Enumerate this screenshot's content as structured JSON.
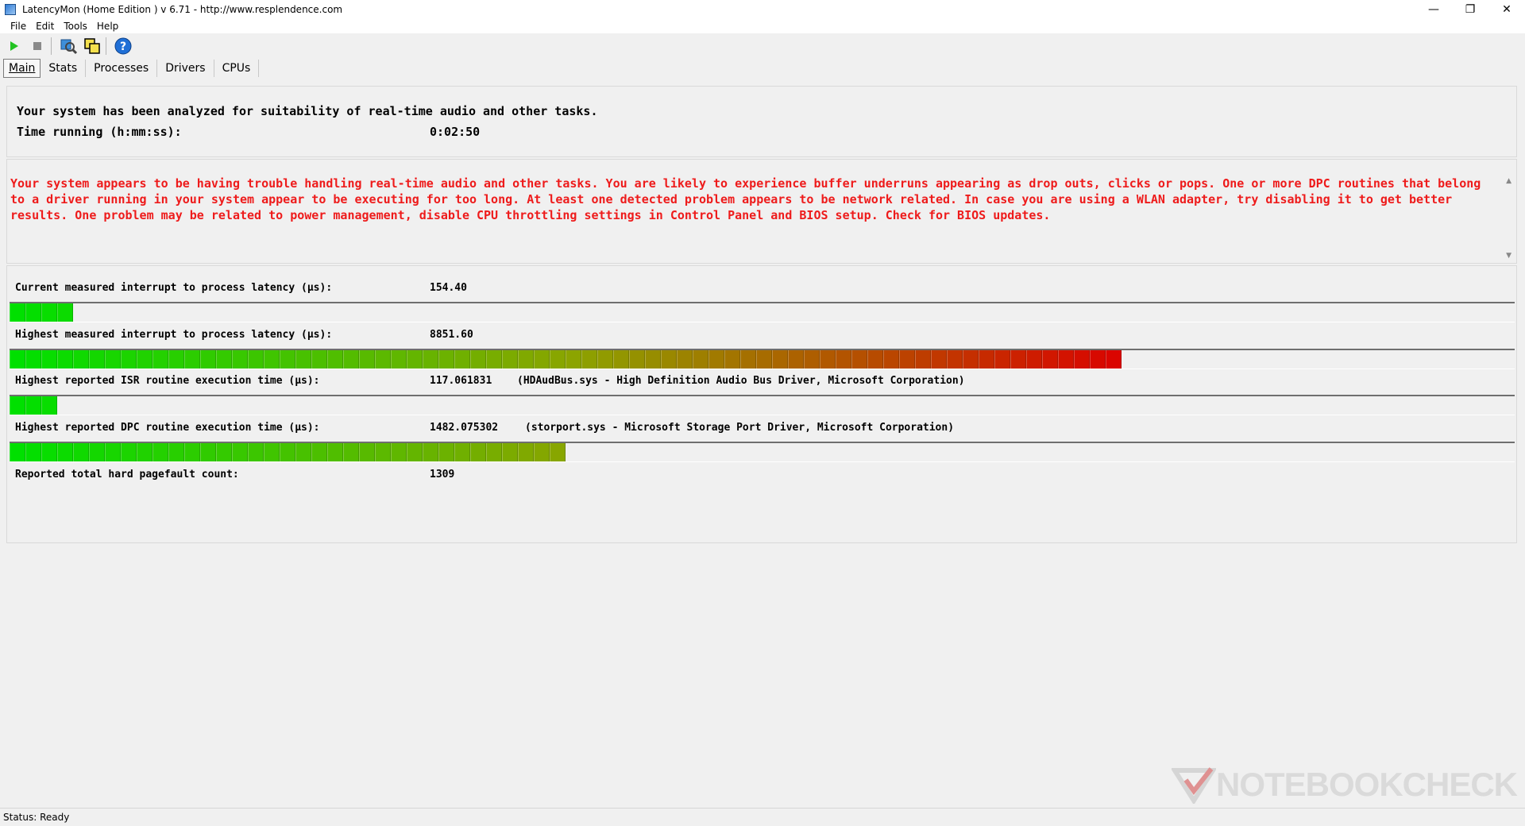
{
  "window": {
    "title": "LatencyMon  (Home Edition )  v 6.71 - http://www.resplendence.com",
    "controls": {
      "minimize": "—",
      "restore": "❐",
      "close": "✕"
    }
  },
  "menu": [
    "File",
    "Edit",
    "Tools",
    "Help"
  ],
  "toolbar": {
    "icons": [
      "play-icon",
      "stop-icon",
      "analyze-icon",
      "copy-windows-icon",
      "help-icon"
    ],
    "colors": {
      "play": "#22c322",
      "stop": "#8a8a8a",
      "help": "#1f6fd6"
    }
  },
  "tabs": [
    {
      "label": "Main",
      "active": true
    },
    {
      "label": "Stats",
      "active": false
    },
    {
      "label": "Processes",
      "active": false
    },
    {
      "label": "Drivers",
      "active": false
    },
    {
      "label": "CPUs",
      "active": false
    }
  ],
  "summary": {
    "analyzed_text": "Your system has been analyzed for suitability of real-time audio and other tasks.",
    "time_label": "Time running (h:mm:ss):",
    "time_value": "0:02:50"
  },
  "warning": {
    "text": "Your system appears to be having trouble handling real-time audio and other tasks. You are likely to experience buffer underruns appearing as drop outs, clicks or pops. One or more DPC routines that belong to a driver running in your system appear to be executing for too long. At least one detected problem appears to be network related. In case you are using a WLAN adapter, try disabling it to get better results. One problem may be related to power management, disable CPU throttling settings in Control Panel and BIOS setup. Check for BIOS updates.",
    "color": "#ee1b1b"
  },
  "metrics": {
    "current_latency": {
      "label": "Current measured interrupt to process latency (µs):",
      "value": "154.40",
      "bar_level": 0.044
    },
    "highest_latency": {
      "label": "Highest measured interrupt to process latency (µs):",
      "value": "8851.60",
      "bar_level": 0.74
    },
    "isr": {
      "label": "Highest reported ISR routine execution time (µs):",
      "value": "117.061831",
      "extra": "(HDAudBus.sys - High Definition Audio Bus Driver, Microsoft Corporation)",
      "bar_level": 0.033
    },
    "dpc": {
      "label": "Highest reported DPC routine execution time (µs):",
      "value": "1482.075302",
      "extra": "(storport.sys - Microsoft Storage Port Driver, Microsoft Corporation)",
      "bar_level": 0.37
    },
    "pagefault": {
      "label": "Reported total hard pagefault count:",
      "value": "1309"
    }
  },
  "status": {
    "text": "Status: Ready"
  },
  "watermark": {
    "text": "NOTEBOOKCHECK"
  }
}
